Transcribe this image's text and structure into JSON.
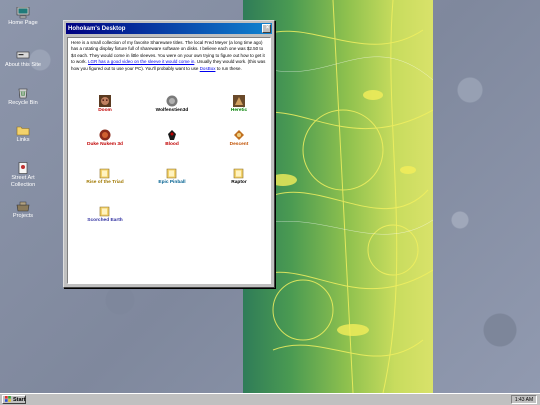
{
  "desktop": {
    "icons": [
      {
        "label": "Home Page",
        "icon": "computer-icon"
      },
      {
        "label": "About this Site",
        "icon": "drive-icon"
      },
      {
        "label": "Recycle Bin",
        "icon": "recycle-bin-icon"
      },
      {
        "label": "Links",
        "icon": "folder-icon"
      },
      {
        "label": "Street Art Collection",
        "icon": "art-collection-icon"
      },
      {
        "label": "Projects",
        "icon": "projects-icon"
      }
    ]
  },
  "window": {
    "title": "Hohokam's Desktop",
    "intro": "Here is a small collection of my favorite Shareware titles. The local Fred Meyer (a long time ago) has a rotating display fixture full of shareware software on disks. I believe each one was $2.50 to $4 each. They would come in little sleeves. You were on your own trying to figure out how to get it to work. ",
    "link1": "LGR has a good video on the sleeve it would come in",
    "mid": ". Usually they would work. (this was how you figured out to use your PC). You'll probably want to use ",
    "link2": "DosBox",
    "end": " to run these."
  },
  "games": [
    {
      "label": "Doom",
      "icon": "doom-icon",
      "color": "#c00000"
    },
    {
      "label": "Wolfenstien3d",
      "icon": "wolfenstein-icon",
      "color": "#000000"
    },
    {
      "label": "Heretic",
      "icon": "heretic-icon",
      "color": "#008000"
    },
    {
      "label": "Duke Nukem 3d",
      "icon": "duke-nukem-icon",
      "color": "#c00000"
    },
    {
      "label": "Blood",
      "icon": "blood-icon",
      "color": "#c00000"
    },
    {
      "label": "Descent",
      "icon": "descent-icon",
      "color": "#c05000"
    },
    {
      "label": "Rise of the Triad",
      "icon": "folder-icon",
      "color": "#a07800"
    },
    {
      "label": "Epic Pinball",
      "icon": "folder-icon",
      "color": "#006090"
    },
    {
      "label": "Raptor",
      "icon": "folder-icon",
      "color": "#000000"
    },
    {
      "label": "Scorched Earth",
      "icon": "folder-icon",
      "color": "#3030a0"
    }
  ],
  "taskbar": {
    "start_label": "Start",
    "clock": "1:43 AM"
  }
}
